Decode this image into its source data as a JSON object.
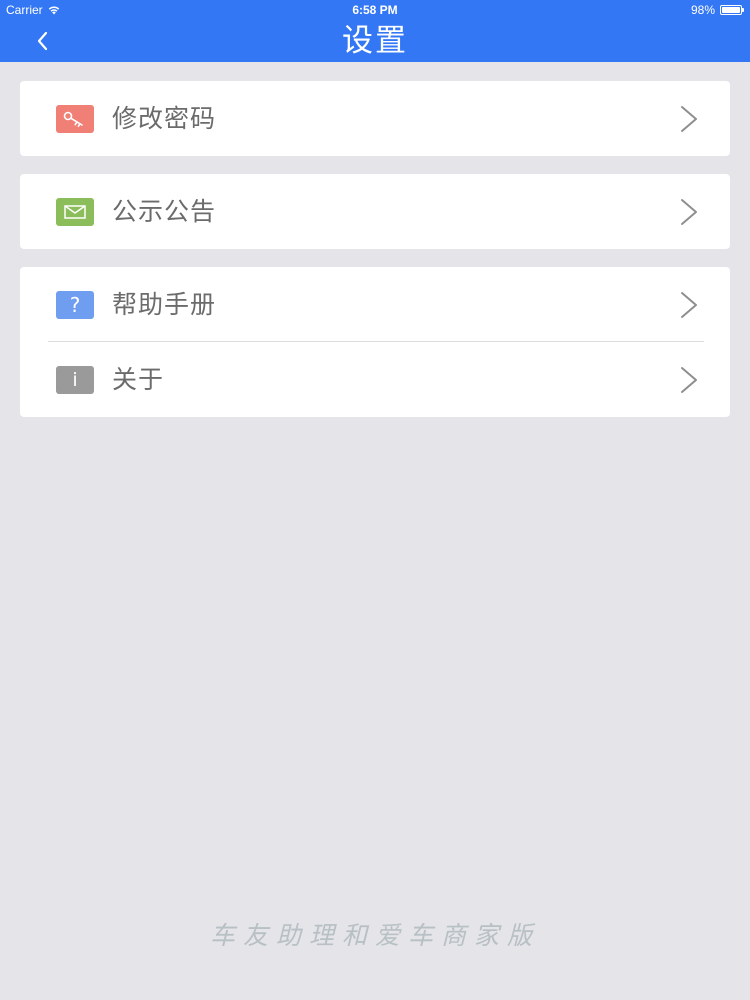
{
  "status_bar": {
    "carrier": "Carrier",
    "time": "6:58 PM",
    "battery": "98%",
    "battery_level": 0.98
  },
  "nav": {
    "title": "设置",
    "back_icon": "chevron-left-icon"
  },
  "menu": {
    "change_password": {
      "label": "修改密码",
      "icon": "key-icon",
      "icon_color": "#f07f76"
    },
    "announcements": {
      "label": "公示公告",
      "icon": "envelope-icon",
      "icon_color": "#8bbd5a"
    },
    "help_manual": {
      "label": "帮助手册",
      "icon": "question-icon",
      "icon_color": "#6f9ef0",
      "glyph": "?"
    },
    "about": {
      "label": "关于",
      "icon": "info-icon",
      "icon_color": "#9a9a9a",
      "glyph": "i"
    }
  },
  "footer": {
    "brand": "车友助理和爱车商家版"
  },
  "colors": {
    "accent": "#3477f5",
    "background": "#e5e4e9"
  }
}
